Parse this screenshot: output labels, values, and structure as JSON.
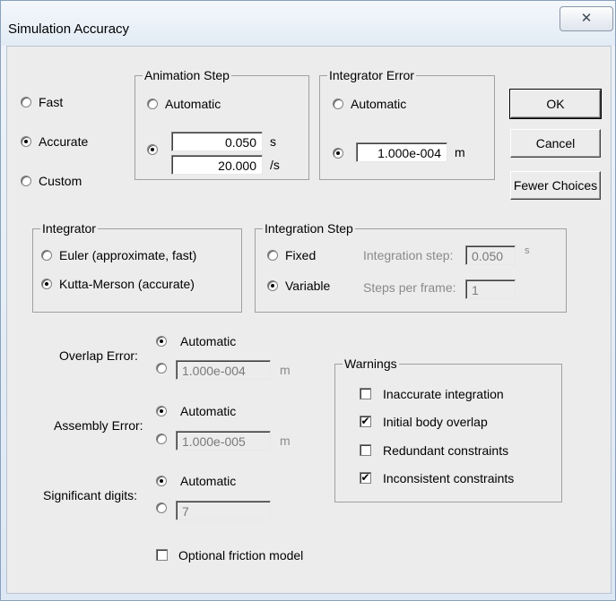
{
  "window": {
    "title": "Simulation Accuracy",
    "close_glyph": "✕"
  },
  "accuracy": {
    "options": [
      "Fast",
      "Accurate",
      "Custom"
    ],
    "selected": "Accurate"
  },
  "animation_step": {
    "legend": "Animation Step",
    "automatic_label": "Automatic",
    "step_value": "0.050",
    "step_unit": "s",
    "rate_value": "20.000",
    "rate_unit": "/s",
    "selected": "custom"
  },
  "integrator_error": {
    "legend": "Integrator Error",
    "automatic_label": "Automatic",
    "value": "1.000e-004",
    "unit": "m",
    "selected": "custom"
  },
  "buttons": {
    "ok": "OK",
    "cancel": "Cancel",
    "fewer": "Fewer Choices"
  },
  "integrator": {
    "legend": "Integrator",
    "options": [
      "Euler (approximate, fast)",
      "Kutta-Merson (accurate)"
    ],
    "selected": "Kutta-Merson (accurate)"
  },
  "integration_step": {
    "legend": "Integration Step",
    "options": [
      "Fixed",
      "Variable"
    ],
    "selected": "Variable",
    "step_label": "Integration step:",
    "step_value": "0.050",
    "step_unit": "s",
    "frame_label": "Steps per frame:",
    "frame_value": "1"
  },
  "overlap_error": {
    "label": "Overlap Error:",
    "automatic_label": "Automatic",
    "value": "1.000e-004",
    "unit": "m",
    "selected": "automatic"
  },
  "assembly_error": {
    "label": "Assembly Error:",
    "automatic_label": "Automatic",
    "value": "1.000e-005",
    "unit": "m",
    "selected": "automatic"
  },
  "significant_digits": {
    "label": "Significant digits:",
    "automatic_label": "Automatic",
    "value": "7",
    "selected": "automatic"
  },
  "warnings": {
    "legend": "Warnings",
    "items": [
      {
        "label": "Inaccurate integration",
        "checked": false
      },
      {
        "label": "Initial body overlap",
        "checked": true
      },
      {
        "label": "Redundant constraints",
        "checked": false
      },
      {
        "label": "Inconsistent constraints",
        "checked": true
      }
    ]
  },
  "friction": {
    "label": "Optional friction model",
    "checked": false
  },
  "check_glyph": "✔"
}
